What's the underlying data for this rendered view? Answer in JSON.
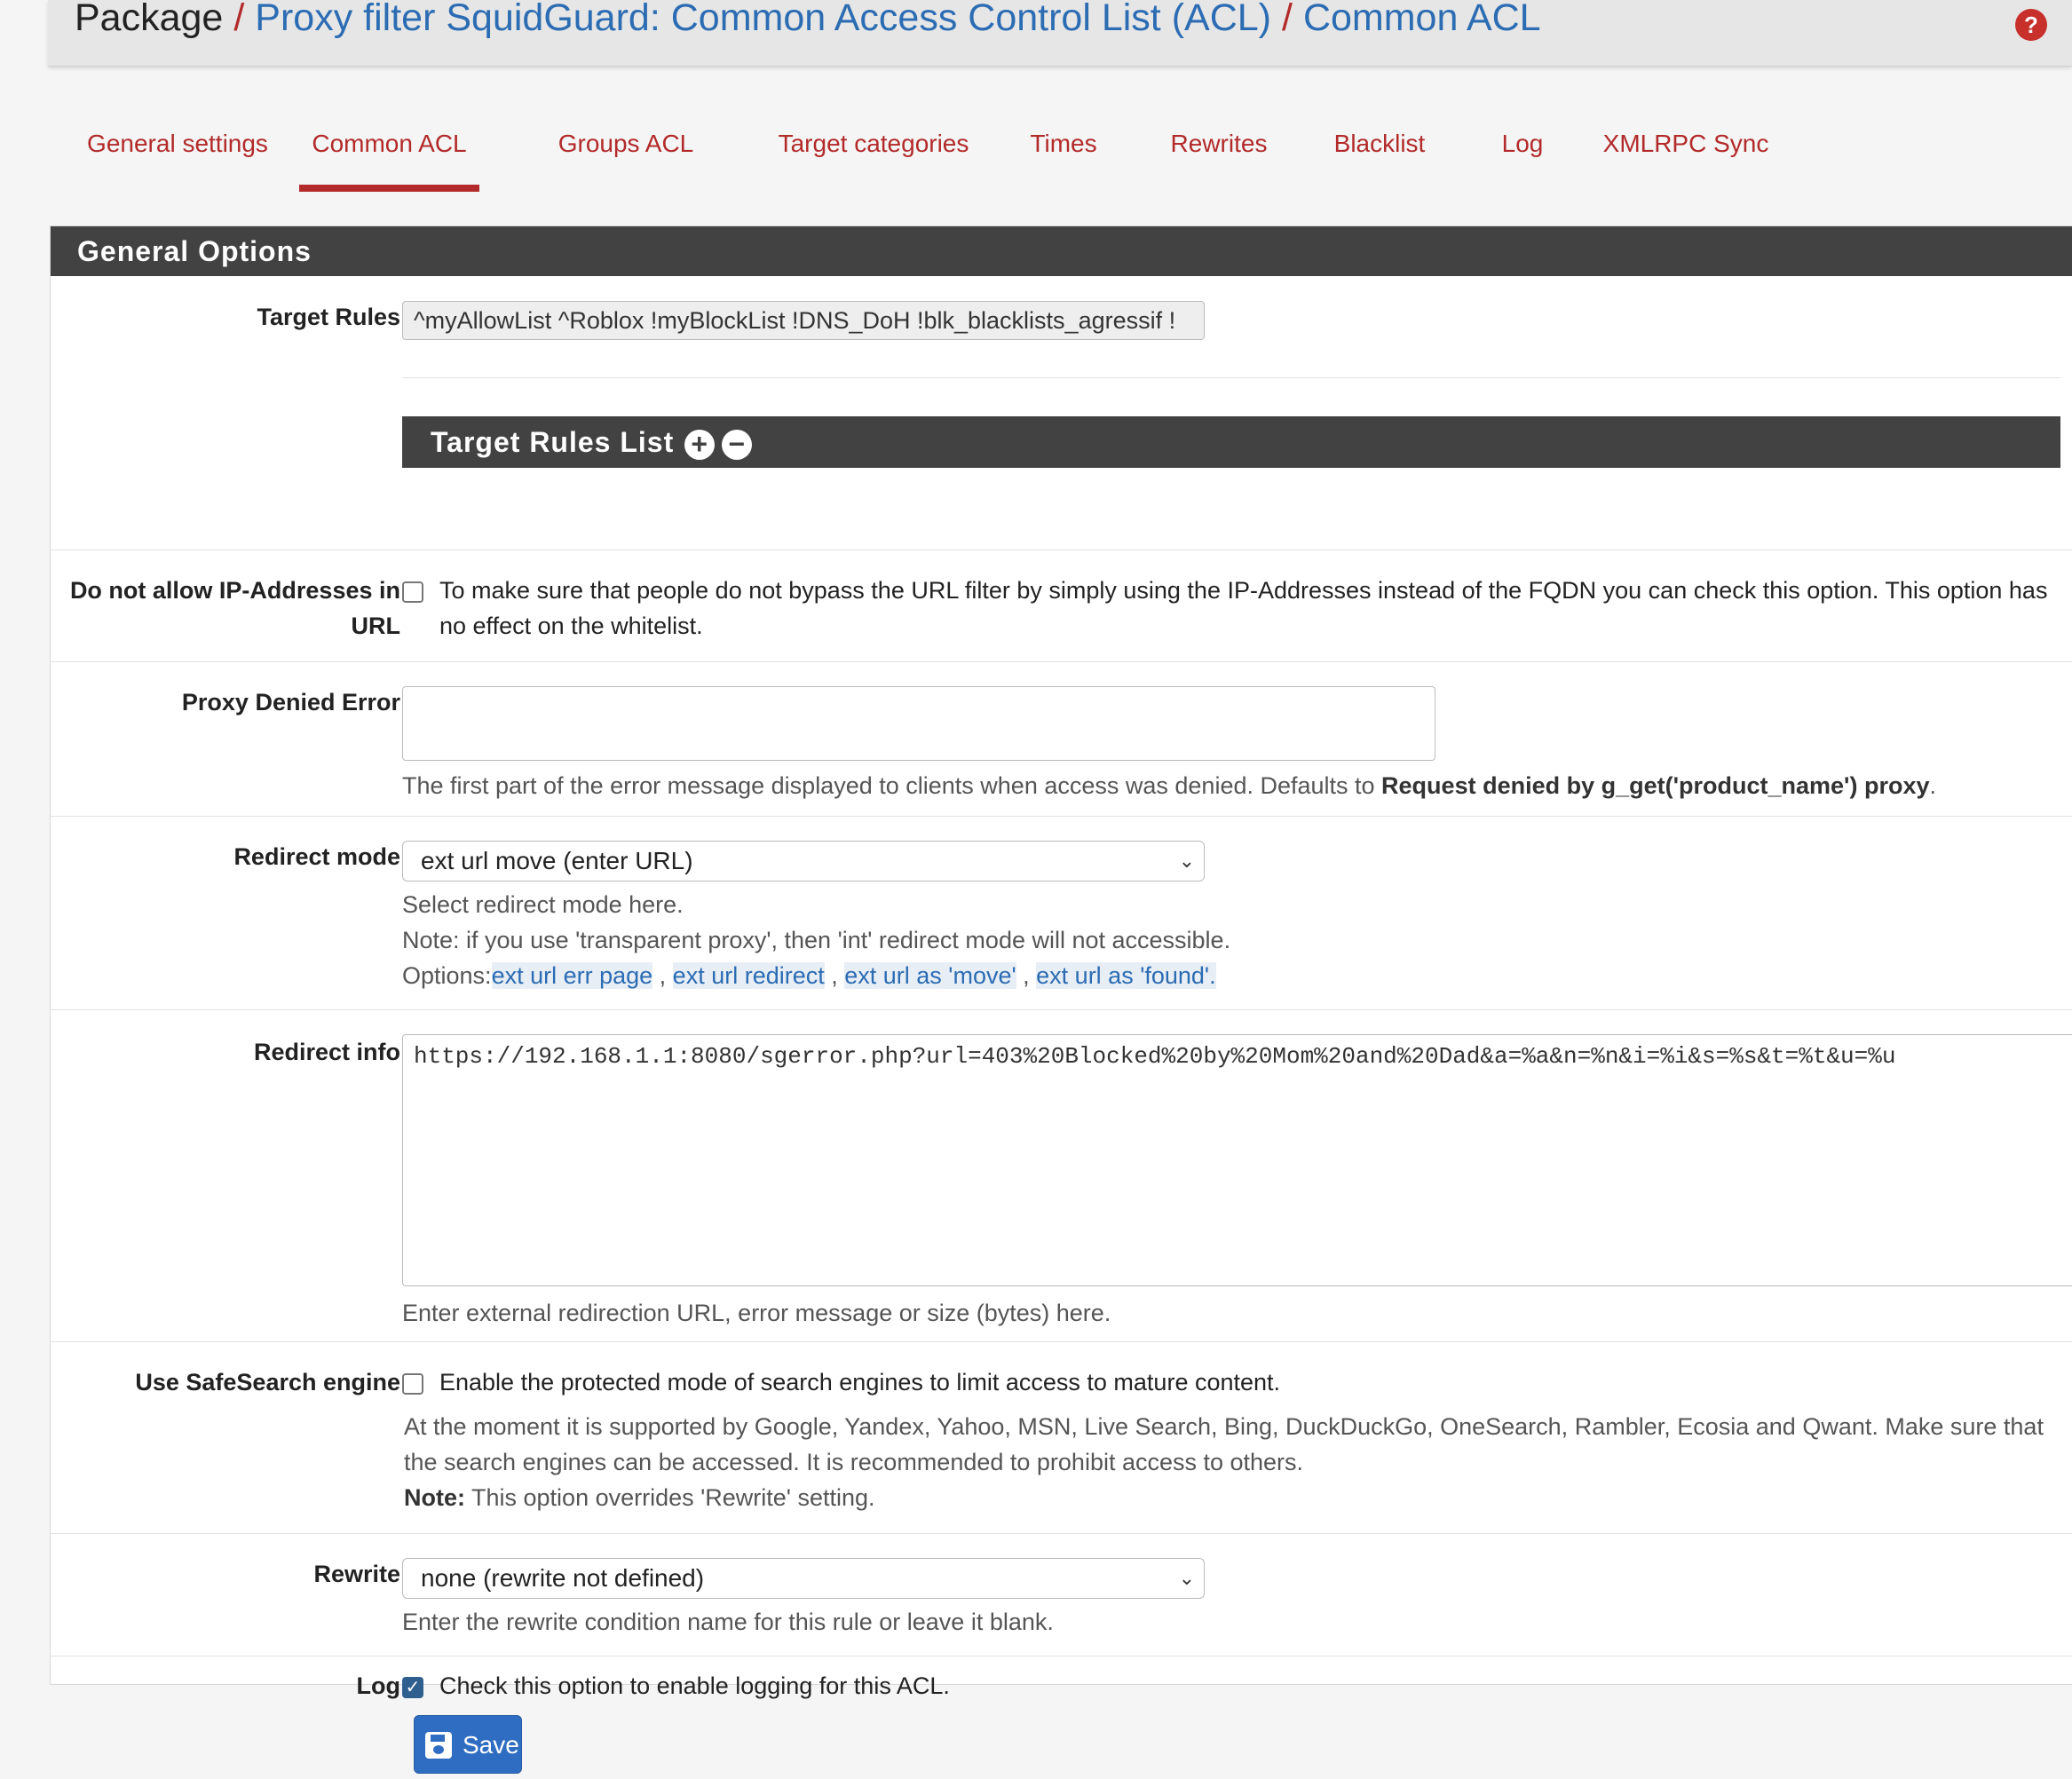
{
  "header": {
    "package": "Package",
    "separator": "/",
    "crumb1": "Proxy filter SquidGuard: Common Access Control List (ACL)",
    "crumb2": "Common ACL",
    "help": "?"
  },
  "tabs": [
    {
      "label": "General settings",
      "active": false
    },
    {
      "label": "Common ACL",
      "active": true
    },
    {
      "label": "Groups ACL",
      "active": false
    },
    {
      "label": "Target categories",
      "active": false
    },
    {
      "label": "Times",
      "active": false
    },
    {
      "label": "Rewrites",
      "active": false
    },
    {
      "label": "Blacklist",
      "active": false
    },
    {
      "label": "Log",
      "active": false
    },
    {
      "label": "XMLRPC Sync",
      "active": false
    }
  ],
  "panel": {
    "title": "General Options",
    "target_rules": {
      "label": "Target Rules",
      "value": "^myAllowList ^Roblox !myBlockList !DNS_DoH !blk_blacklists_agressif !",
      "list_title": "Target Rules List"
    },
    "no_ip": {
      "label": "Do not allow IP-Addresses in URL",
      "checked": false,
      "text": "To make sure that people do not bypass the URL filter by simply using the IP-Addresses instead of the FQDN you can check this option. This option has no effect on the whitelist."
    },
    "proxy_denied": {
      "label": "Proxy Denied Error",
      "value": "",
      "help_prefix": "The first part of the error message displayed to clients when access was denied. Defaults to ",
      "help_bold": "Request denied by g_get('product_name') proxy",
      "help_suffix": "."
    },
    "redirect_mode": {
      "label": "Redirect mode",
      "value": "ext url move (enter URL)",
      "help1": "Select redirect mode here.",
      "help2": "Note: if you use 'transparent proxy', then 'int' redirect mode will not accessible.",
      "options_label": "Options:",
      "options": [
        "ext url err page",
        "ext url redirect",
        "ext url as 'move'",
        "ext url as 'found'."
      ]
    },
    "redirect_info": {
      "label": "Redirect info",
      "value": "https://192.168.1.1:8080/sgerror.php?url=403%20Blocked%20by%20Mom%20and%20Dad&a=%a&n=%n&i=%i&s=%s&t=%t&u=%u",
      "help": "Enter external redirection URL, error message or size (bytes) here."
    },
    "safesearch": {
      "label": "Use SafeSearch engine",
      "checked": false,
      "text": "Enable the protected mode of search engines to limit access to mature content.",
      "help1": "At the moment it is supported by Google, Yandex, Yahoo, MSN, Live Search, Bing, DuckDuckGo, OneSearch, Rambler, Ecosia and Qwant. Make sure that the search engines can be accessed. It is recommended to prohibit access to others.",
      "note_bold": "Note:",
      "note_text": " This option overrides 'Rewrite' setting."
    },
    "rewrite": {
      "label": "Rewrite",
      "value": "none (rewrite not defined)",
      "help": "Enter the rewrite condition name for this rule or leave it blank."
    },
    "log": {
      "label": "Log",
      "checked": true,
      "text": "Check this option to enable logging for this ACL."
    }
  },
  "save_label": "Save",
  "colors": {
    "accent": "#b32a2a",
    "link": "#2b6cb3",
    "heading_bg": "#424242",
    "save": "#2f6dc2"
  }
}
